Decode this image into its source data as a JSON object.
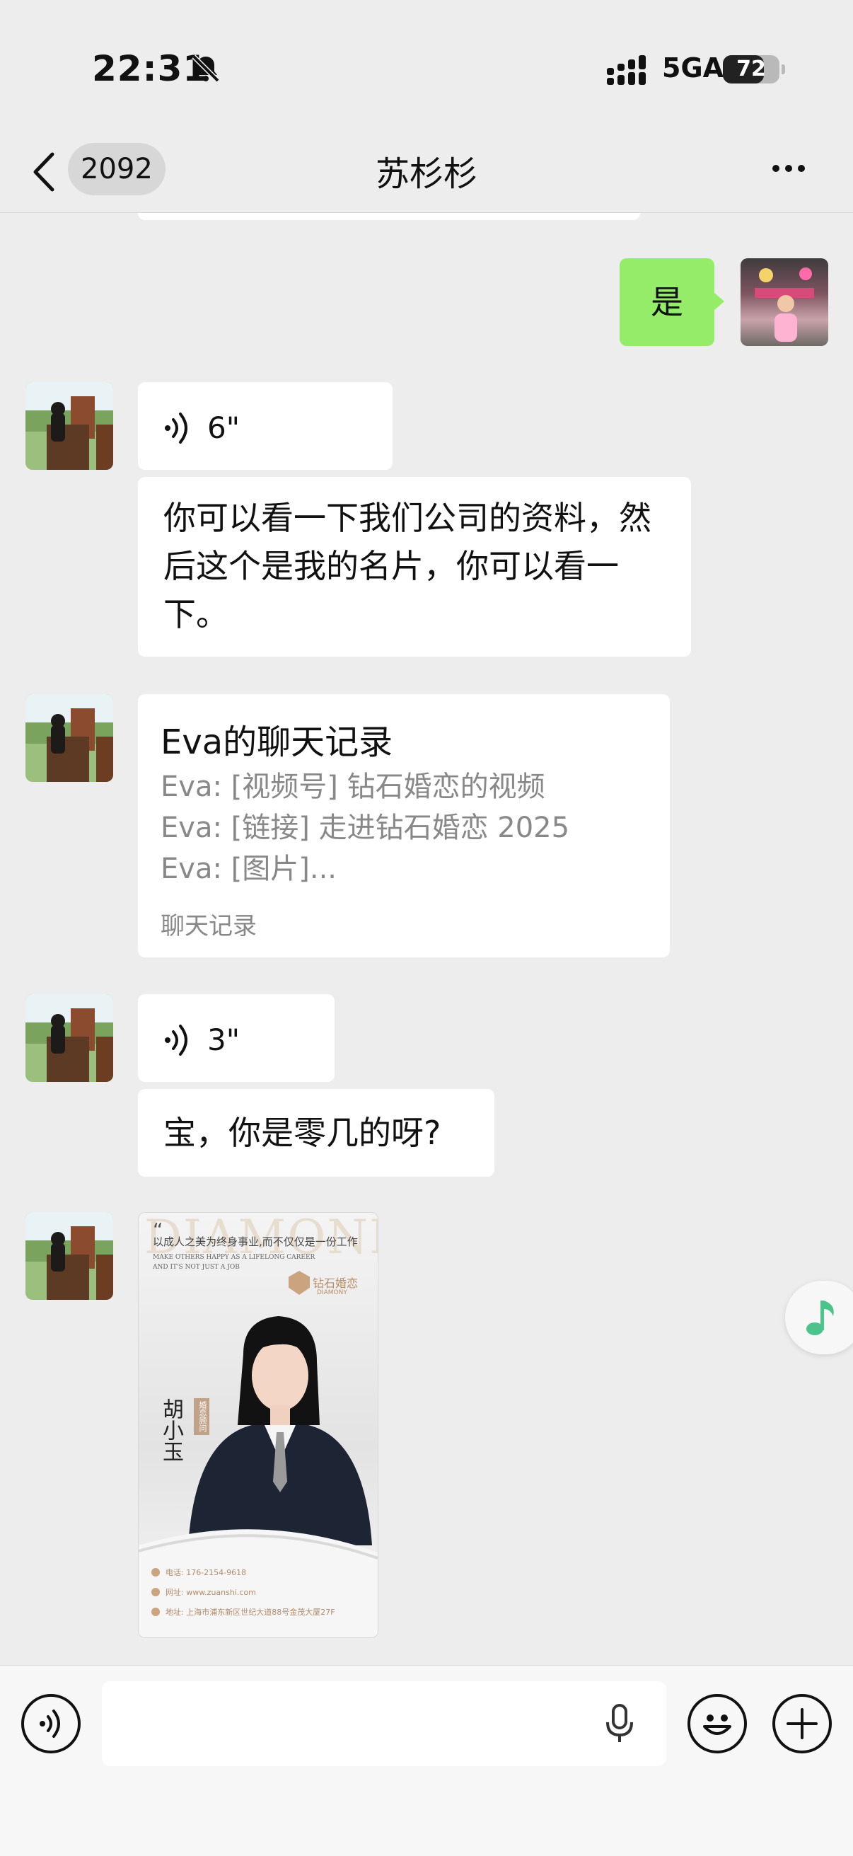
{
  "status_bar": {
    "time": "22:31",
    "network": "5GA",
    "battery": "72",
    "icons": [
      "bell-muted-icon",
      "signal-icon",
      "battery-icon"
    ]
  },
  "header": {
    "unread_count": "2092",
    "title": "苏杉杉",
    "icons": [
      "back-icon",
      "more-icon"
    ]
  },
  "messages": {
    "sent_reply": "是",
    "voice1": "6\"",
    "text1": "你可以看一下我们公司的资料，然后这个是我的名片，你可以看一下。",
    "record": {
      "title": "Eva的聊天记录",
      "lines": [
        "Eva: [视频号] 钻石婚恋的视频",
        "Eva: [链接] 走进钻石婚恋 2025",
        "Eva: [图片]..."
      ],
      "footer": "聊天记录"
    },
    "voice2": "3\"",
    "text2": "宝，你是零几的呀?"
  },
  "card": {
    "watermark": "DIAMOND",
    "slogan": "以成人之美为终身事业,而不仅仅是一份工作",
    "slogan_en_1": "MAKE OTHERS HAPPY AS A LIFELONG CAREER",
    "slogan_en_2": "AND IT'S NOT JUST A JOB",
    "brand_cn": "钻石婚恋",
    "brand_en": "DIAMONY",
    "name": "胡小玉",
    "role": "婚恋顾问",
    "phone": "电话: 176-2154-9618",
    "website": "网址: www.zuanshi.com",
    "address": "地址: 上海市浦东新区世纪大道88号金茂大厦27F"
  },
  "colors": {
    "background": "#ededed",
    "sent_bubble": "#95ec69",
    "received_bubble": "#ffffff",
    "accent_green": "#4cc38a"
  },
  "input_bar": {
    "icons": [
      "voice-input-icon",
      "microphone-icon",
      "emoji-icon",
      "plus-icon"
    ]
  }
}
